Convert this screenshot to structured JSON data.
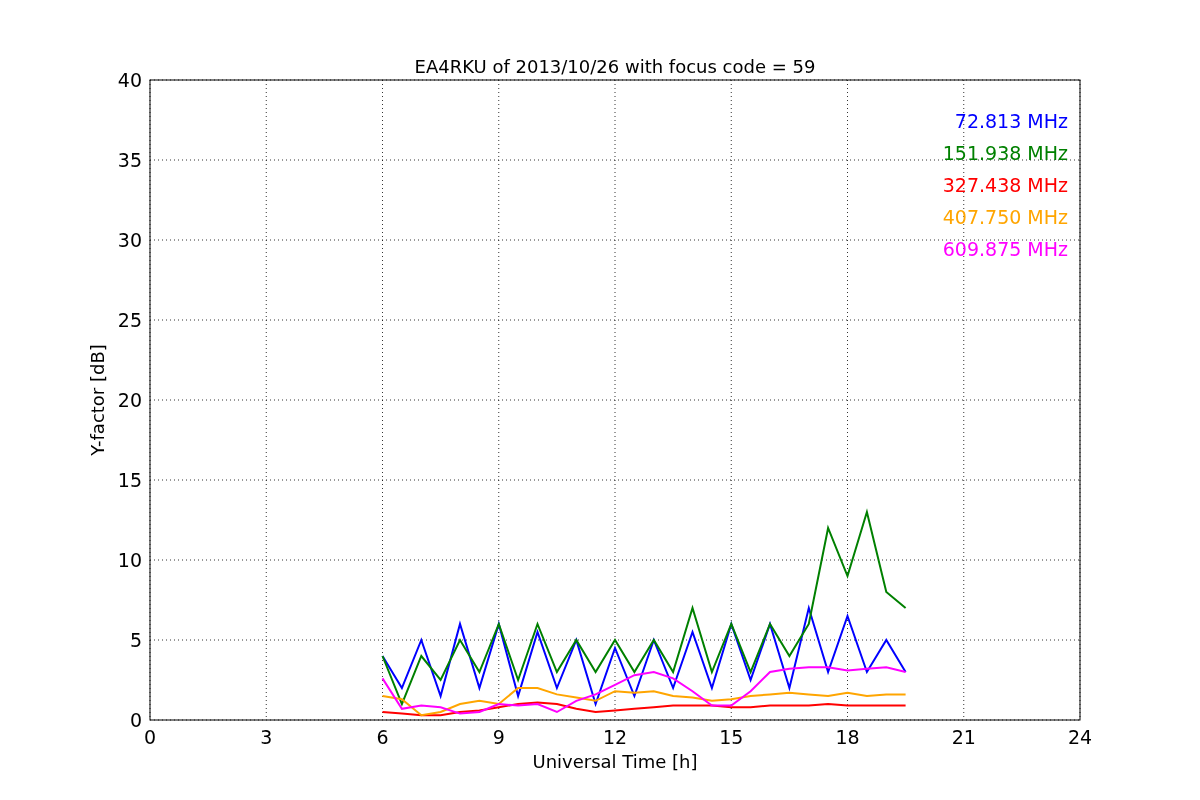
{
  "chart_data": {
    "type": "line",
    "title": "EA4RKU of 2013/10/26 with focus code = 59",
    "xlabel": "Universal Time [h]",
    "ylabel": "Y-factor [dB]",
    "x": [
      6,
      6.5,
      7,
      7.5,
      8,
      8.5,
      9,
      9.5,
      10,
      10.5,
      11,
      11.5,
      12,
      12.5,
      13,
      13.5,
      14,
      14.5,
      15,
      15.5,
      16,
      16.5,
      17,
      17.5,
      18,
      18.5,
      19,
      19.5
    ],
    "series": [
      {
        "name": "72.813 MHz",
        "color": "#0000ff",
        "values": [
          4,
          2,
          5,
          1.5,
          6,
          2,
          6,
          1.5,
          5.5,
          2,
          5,
          1,
          4.5,
          1.5,
          5,
          2,
          5.5,
          2,
          6,
          2.5,
          6,
          2,
          7,
          3,
          6.5,
          3,
          5,
          3
        ]
      },
      {
        "name": "151.938 MHz",
        "color": "#008000",
        "values": [
          4,
          1,
          4,
          2.5,
          5,
          3,
          6,
          2.5,
          6,
          3,
          5,
          3,
          5,
          3,
          5,
          3,
          7,
          3,
          6,
          3,
          6,
          4,
          6,
          12,
          9,
          13,
          8,
          7
        ]
      },
      {
        "name": "327.438 MHz",
        "color": "#ff0000",
        "values": [
          0.5,
          0.4,
          0.3,
          0.3,
          0.5,
          0.6,
          0.8,
          1,
          1.1,
          1,
          0.7,
          0.5,
          0.6,
          0.7,
          0.8,
          0.9,
          0.9,
          0.9,
          0.8,
          0.8,
          0.9,
          0.9,
          0.9,
          1,
          0.9,
          0.9,
          0.9,
          0.9
        ]
      },
      {
        "name": "407.750 MHz",
        "color": "#ffa500",
        "values": [
          1.5,
          1.3,
          0.3,
          0.5,
          1,
          1.2,
          1,
          2,
          2,
          1.6,
          1.4,
          1.2,
          1.8,
          1.7,
          1.8,
          1.5,
          1.4,
          1.2,
          1.3,
          1.5,
          1.6,
          1.7,
          1.6,
          1.5,
          1.7,
          1.5,
          1.6,
          1.6
        ]
      },
      {
        "name": "609.875 MHz",
        "color": "#ff00ff",
        "values": [
          2.6,
          0.7,
          0.9,
          0.8,
          0.4,
          0.5,
          1,
          0.9,
          1,
          0.5,
          1.2,
          1.6,
          2.2,
          2.8,
          3,
          2.6,
          1.8,
          0.9,
          0.9,
          1.8,
          3,
          3.2,
          3.3,
          3.3,
          3.1,
          3.2,
          3.3,
          3
        ]
      }
    ],
    "grid": true,
    "xlim": [
      0,
      24
    ],
    "ylim": [
      0,
      40
    ],
    "xticks": [
      0,
      3,
      6,
      9,
      12,
      15,
      18,
      21,
      24
    ],
    "yticks": [
      0,
      5,
      10,
      15,
      20,
      25,
      30,
      35,
      40
    ]
  }
}
